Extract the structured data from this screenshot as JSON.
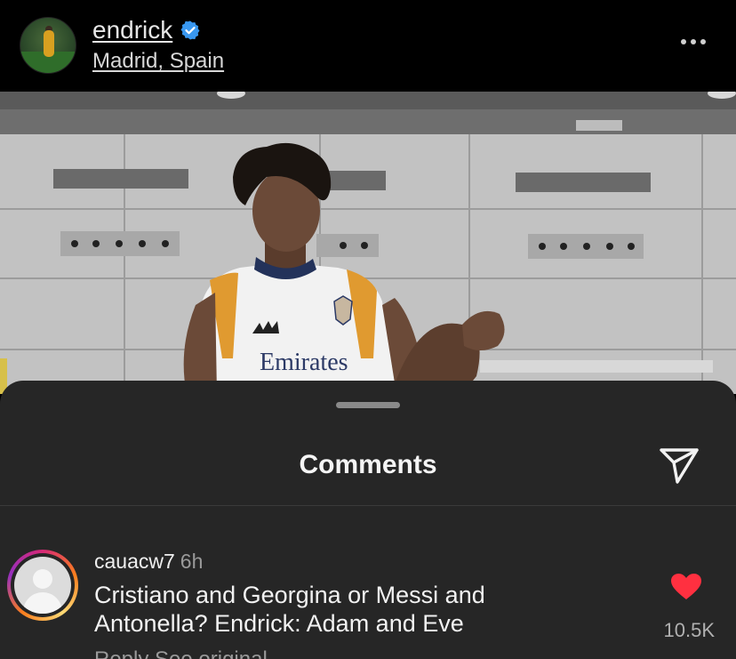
{
  "post": {
    "username": "endrick",
    "location": "Madrid, Spain",
    "verified": true,
    "shirt_text": "Emirates"
  },
  "comments_sheet": {
    "title": "Comments",
    "comment": {
      "username": "cauacw7",
      "time": "6h",
      "text": "Cristiano and Georgina or Messi and Antonella? Endrick: Adam and Eve",
      "likes": "10.5K",
      "liked": true
    },
    "next_comment_partial": "Reply  See original"
  },
  "colors": {
    "verified": "#3897f0",
    "heart": "#ff3040",
    "sheet_bg": "#262626"
  },
  "icons": [
    "verified-badge-icon",
    "more-options-icon",
    "share-icon",
    "heart-icon",
    "default-avatar-icon"
  ]
}
